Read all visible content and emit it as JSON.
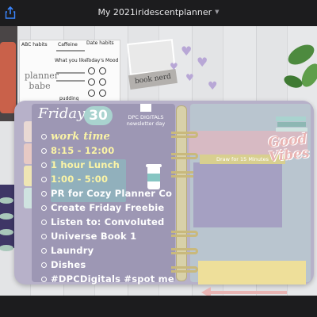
{
  "window": {
    "title": "My 2021iridescentplanner",
    "title_menu_icon": "chevron-down-icon",
    "share_icon": "share-icon"
  },
  "stickers": {
    "sheet_lines": [
      "ABC habits",
      "Caffeine",
      "Date habits",
      "What you like",
      "Today's Mood",
      "100% planner babe",
      "pudding"
    ],
    "planner_babe": "planner babe",
    "book_nerd": "book nerd"
  },
  "planner": {
    "day": "Friday",
    "date": "30",
    "badge_line1": "DPC DIGITALS",
    "badge_line2": "newsletter day",
    "worktime_label": "work time",
    "rows": [
      {
        "text": "8:15 - 12:00",
        "kind": "time"
      },
      {
        "text": "1 hour Lunch",
        "kind": "time"
      },
      {
        "text": "1:00 - 5:00",
        "kind": "time"
      },
      {
        "text": "PR for Cozy Planner Co",
        "kind": "task"
      },
      {
        "text": "Create Friday Freebie",
        "kind": "task"
      },
      {
        "text": "Listen to: Convoluted",
        "kind": "task"
      },
      {
        "text": "Universe Book 1",
        "kind": "task"
      },
      {
        "text": "Laundry",
        "kind": "task"
      },
      {
        "text": "Dishes",
        "kind": "task"
      },
      {
        "text": "#DPCDigitals #spot me",
        "kind": "task"
      }
    ],
    "draw_label": "Draw for 15 Minutes",
    "good_vibes_line1": "Good",
    "good_vibes_line2": "Vibes"
  },
  "colors": {
    "cover": "#b7b1c9",
    "left_page": "#9d97b4",
    "right_page": "#b9c5cf",
    "time_text": "#fbf4a6",
    "accent_teal": "#a9d3cf",
    "rings": "#c9b97c"
  }
}
